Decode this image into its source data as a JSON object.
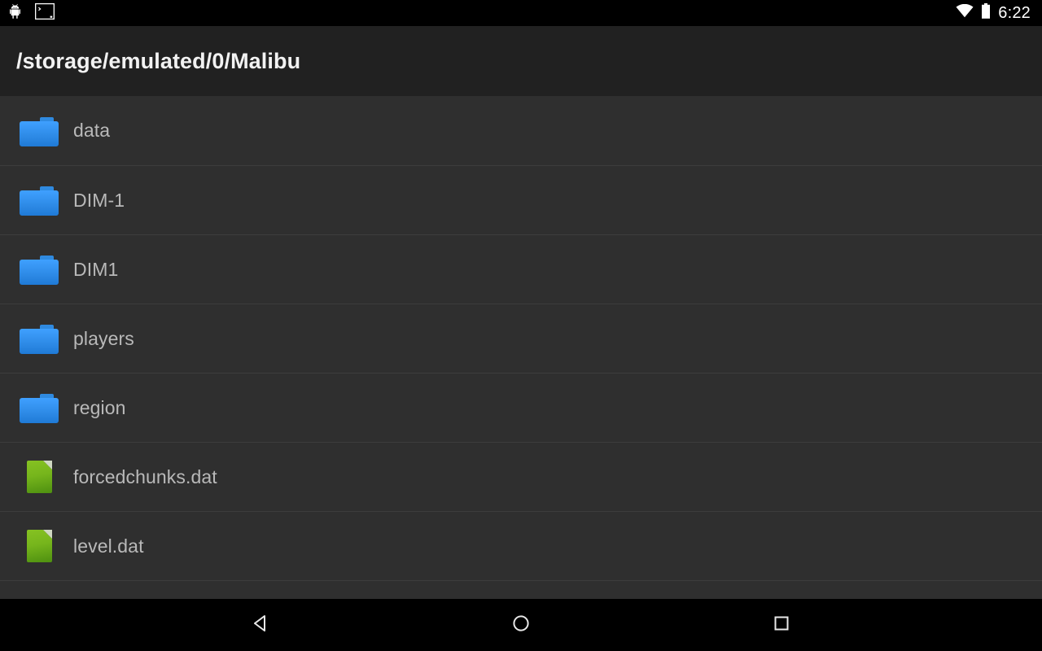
{
  "status_bar": {
    "left_icons": [
      {
        "name": "android-robot-icon",
        "label": "android"
      },
      {
        "name": "terminal-window-icon",
        "label": "terminal"
      }
    ],
    "right_icons": [
      {
        "name": "wifi-icon",
        "label": "wifi"
      },
      {
        "name": "battery-icon",
        "label": "battery"
      }
    ],
    "clock": "6:22"
  },
  "action_bar": {
    "title": "/storage/emulated/0/Malibu"
  },
  "file_list": {
    "rows": [
      {
        "name": "data",
        "type": "folder"
      },
      {
        "name": "DIM-1",
        "type": "folder"
      },
      {
        "name": "DIM1",
        "type": "folder"
      },
      {
        "name": "players",
        "type": "folder"
      },
      {
        "name": "region",
        "type": "folder"
      },
      {
        "name": "forcedchunks.dat",
        "type": "file"
      },
      {
        "name": "level.dat",
        "type": "file"
      },
      {
        "name": "",
        "type": "partial"
      }
    ]
  },
  "nav_bar": {
    "buttons": [
      {
        "name": "back-button",
        "label": "Back"
      },
      {
        "name": "home-button",
        "label": "Home"
      },
      {
        "name": "recents-button",
        "label": "Recents"
      }
    ]
  },
  "colors": {
    "status_bar_bg": "#000000",
    "action_bar_bg": "#212121",
    "list_bg": "#2f2f2f",
    "divider": "#3d3d3d",
    "folder_icon": "#2f8ce8",
    "file_icon": "#76b51c",
    "list_text": "#b9b9b9",
    "title_text": "#f2f2f2"
  }
}
